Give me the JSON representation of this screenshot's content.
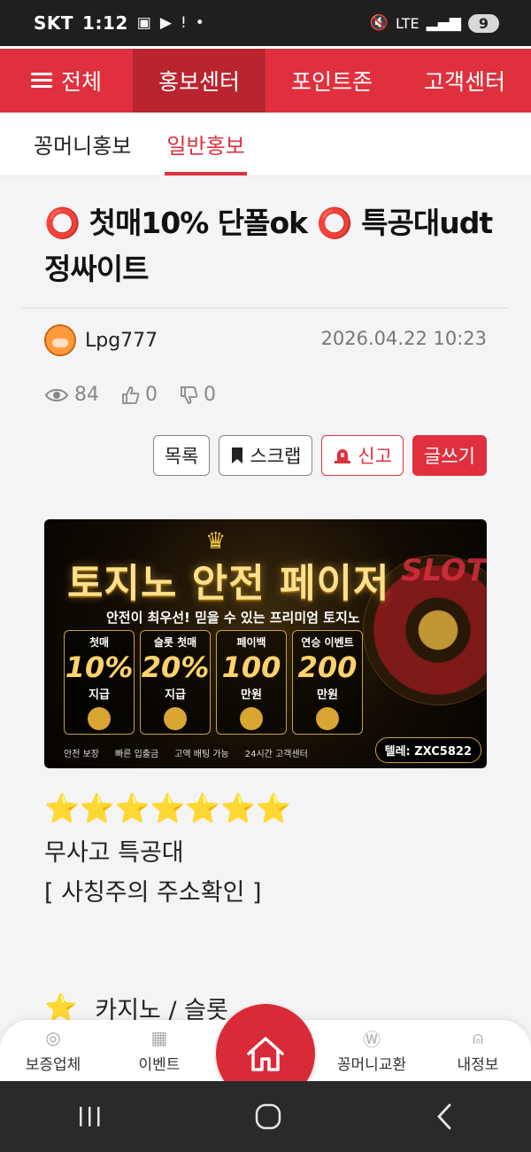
{
  "statusbar": {
    "carrier": "SKT",
    "time": "1:12",
    "network": "LTE",
    "battery": "9"
  },
  "mainnav": {
    "items": [
      "전체",
      "홍보센터",
      "포인트존",
      "고객센터"
    ]
  },
  "subnav": {
    "tabs": [
      "꽁머니홍보",
      "일반홍보"
    ]
  },
  "post": {
    "title": "⭕ 첫매10% 단폴ok ⭕ 특공대udt 정싸이트",
    "author": "Lpg777",
    "date": "2026.04.22 10:23",
    "views": "84",
    "likes": "0",
    "dislikes": "0"
  },
  "actions": {
    "list": "목록",
    "scrap": "스크랩",
    "report": "신고",
    "write": "글쓰기"
  },
  "banner": {
    "title": "토지노 안전 페이저",
    "subtitle": "안전이 최우선! 믿을 수 있는 프리미엄 토지노",
    "watermark": "SLOT",
    "cards": [
      {
        "label": "첫매",
        "value": "10%",
        "unit": "지급"
      },
      {
        "label": "슬롯 첫매",
        "value": "20%",
        "unit": "지급"
      },
      {
        "label": "페이백",
        "value": "100",
        "unit": "만원"
      },
      {
        "label": "연승 이벤트",
        "value": "200",
        "unit": "만원"
      }
    ],
    "features": [
      "안전 보장",
      "빠른 입출금",
      "고액 배팅 가능",
      "24시간 고객센터"
    ],
    "telegram": "텔레: ZXC5822"
  },
  "content": {
    "stars": "⭐⭐⭐⭐⭐⭐⭐",
    "line1": "무사고 특공대",
    "line2": "[ 사칭주의 주소확인 ]",
    "category": "카지노 / 슬롯"
  },
  "tabbar": {
    "items": [
      "보증업체",
      "이벤트",
      "꽁머니교환",
      "내정보"
    ]
  },
  "colors": {
    "accent": "#e0303e",
    "accent_dark": "#b8252f"
  }
}
